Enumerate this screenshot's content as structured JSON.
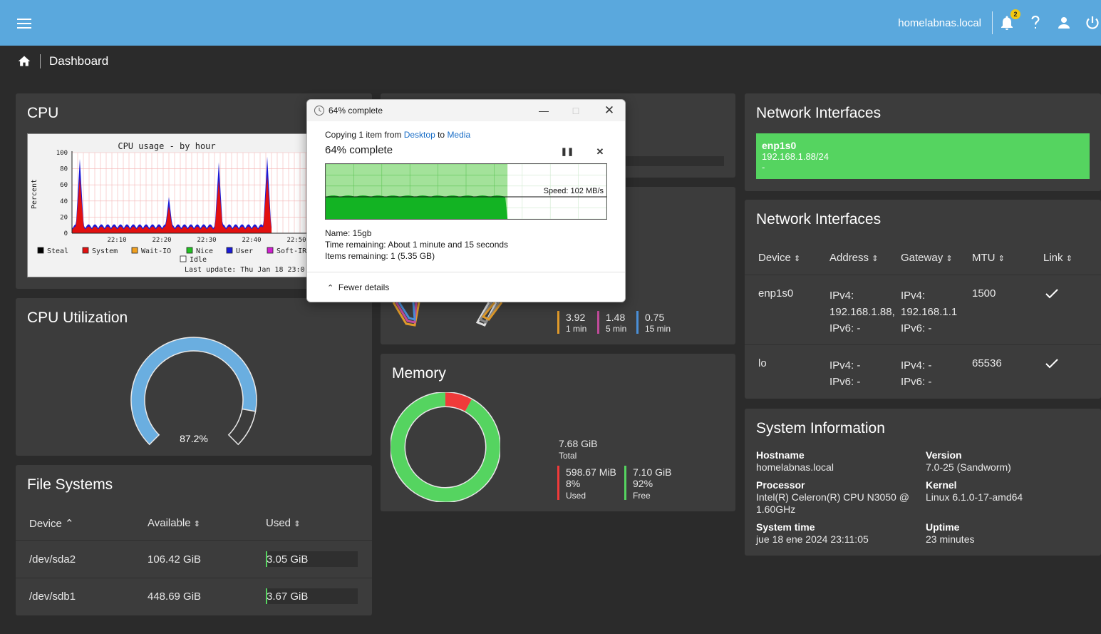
{
  "topbar": {
    "hostname": "homelabnas.local",
    "notification_count": "2",
    "icons": [
      "menu-icon",
      "bell-icon",
      "help-icon",
      "user-icon",
      "power-icon"
    ]
  },
  "breadcrumb": {
    "title": "Dashboard"
  },
  "cpu": {
    "title": "CPU",
    "graph": {
      "title": "CPU usage - by hour",
      "ylabel": "Percent",
      "y_ticks": [
        "100",
        "80",
        "60",
        "40",
        "20",
        "0"
      ],
      "x_ticks": [
        "22:10",
        "22:20",
        "22:30",
        "22:40",
        "22:50"
      ],
      "legend": [
        "Steal",
        "System",
        "Wait-IO",
        "Nice",
        "User",
        "Soft-IRQ",
        "Idle"
      ],
      "last_update": "Last update: Thu Jan 18 23:0"
    }
  },
  "cpu_utilization": {
    "title": "CPU Utilization",
    "value_label": "87.2%",
    "value": 87.2
  },
  "file_systems": {
    "title": "File Systems",
    "headers": [
      "Device",
      "Available",
      "Used"
    ],
    "rows": [
      {
        "device": "/dev/sda2",
        "available": "106.42 GiB",
        "used": "3.05 GiB",
        "fill": 0.01
      },
      {
        "device": "/dev/sdb1",
        "available": "448.69 GiB",
        "used": "3.67 GiB",
        "fill": 0.01
      }
    ]
  },
  "load": {
    "values": [
      {
        "value": "3.92",
        "label": "1 min",
        "color": "#e09a2a"
      },
      {
        "value": "1.48",
        "label": "5 min",
        "color": "#c04b9a"
      },
      {
        "value": "0.75",
        "label": "15 min",
        "color": "#4a8fd8"
      }
    ]
  },
  "memory": {
    "title": "Memory",
    "total_value": "7.68 GiB",
    "total_label": "Total",
    "used": {
      "value": "598.67 MiB",
      "percent": "8%",
      "label": "Used",
      "color": "#f03a3a"
    },
    "free": {
      "value": "7.10 GiB",
      "percent": "92%",
      "label": "Free",
      "color": "#55d460"
    },
    "used_fraction": 0.08
  },
  "network_summary": {
    "title": "Network Interfaces",
    "iface": {
      "name": "enp1s0",
      "address": "192.168.1.88/24",
      "extra": "-"
    }
  },
  "network_table": {
    "title": "Network Interfaces",
    "headers": [
      "Device",
      "Address",
      "Gateway",
      "MTU",
      "Link"
    ],
    "rows": [
      {
        "device": "enp1s0",
        "addr1": "IPv4:",
        "addr2": "192.168.1.88,",
        "addr3": "IPv6: -",
        "gw1": "IPv4:",
        "gw2": "192.168.1.1",
        "gw3": "IPv6: -",
        "mtu": "1500"
      },
      {
        "device": "lo",
        "addr1": "IPv4: -",
        "addr2": "IPv6: -",
        "gw1": "IPv4: -",
        "gw2": "IPv6: -",
        "mtu": "65536"
      }
    ]
  },
  "system_info": {
    "title": "System Information",
    "hostname_label": "Hostname",
    "hostname": "homelabnas.local",
    "version_label": "Version",
    "version": "7.0-25 (Sandworm)",
    "processor_label": "Processor",
    "processor_1": "Intel(R) Celeron(R) CPU N3050 @",
    "processor_2": "1.60GHz",
    "kernel_label": "Kernel",
    "kernel": "Linux 6.1.0-17-amd64",
    "time_label": "System time",
    "time": "jue 18 ene 2024 23:11:05",
    "uptime_label": "Uptime",
    "uptime": "23 minutes"
  },
  "copy_dialog": {
    "title": "64% complete",
    "copying_prefix": "Copying 1 item from ",
    "source": "Desktop",
    "to": " to ",
    "destination": "Media",
    "progress_text": "64% complete",
    "progress": 0.64,
    "speed": "Speed: 102 MB/s",
    "name": "Name:  15gb",
    "time_remaining": "Time remaining:  About 1 minute and 15 seconds",
    "items_remaining": "Items remaining:  1 (5.35 GB)",
    "fewer_details": "Fewer details"
  }
}
